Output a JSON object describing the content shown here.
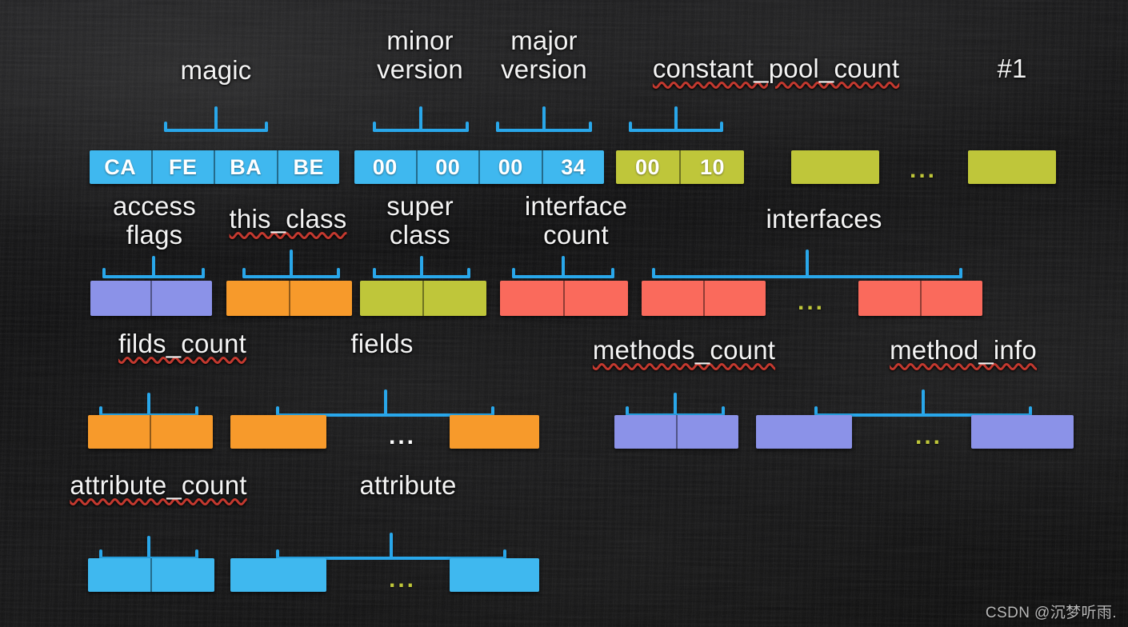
{
  "diagram": {
    "title": "Java .class file structure byte layout",
    "colors": {
      "blue": "#3fb8ef",
      "light_blue": "#3fb8ef",
      "olive": "#bfc63a",
      "lavender": "#8b92e8",
      "orange": "#f79a2b",
      "salmon": "#fa6a5c",
      "bracket": "#29a7ea",
      "label_text": "#f4f4f4",
      "spellcheck_underline": "#c4392f",
      "background": "#0d0d0e"
    },
    "rows": [
      {
        "id": "row-1",
        "labels": [
          {
            "id": "magic",
            "text": "magic",
            "spellcheck": false
          },
          {
            "id": "minor-version",
            "text": "minor\nversion",
            "spellcheck": false
          },
          {
            "id": "major-version",
            "text": "major\nversion",
            "spellcheck": false
          },
          {
            "id": "constant-pool-count",
            "text": "constant_pool_count",
            "spellcheck": true
          },
          {
            "id": "constant-pool-entry",
            "text": "#1",
            "spellcheck": false
          }
        ],
        "groups": [
          {
            "id": "magic-bytes",
            "color": "blue",
            "cells": [
              "CA",
              "FE",
              "BA",
              "BE"
            ]
          },
          {
            "id": "version-bytes",
            "color": "blue",
            "cells": [
              "00",
              "00",
              "00",
              "34"
            ]
          },
          {
            "id": "constant-pool-count-bytes",
            "color": "olive",
            "cells": [
              "00",
              "10"
            ]
          },
          {
            "id": "constant-pool-entry-1",
            "color": "olive",
            "cells": [
              ""
            ]
          },
          {
            "id": "constant-pool-entry-n",
            "color": "olive",
            "cells": [
              ""
            ]
          }
        ],
        "ellipsis": [
          {
            "id": "constant-pool-ellipsis",
            "text": "...",
            "color": "olive"
          }
        ]
      },
      {
        "id": "row-2",
        "labels": [
          {
            "id": "access-flags",
            "text": "access\nflags",
            "spellcheck": false
          },
          {
            "id": "this-class",
            "text": "this_class",
            "spellcheck": true
          },
          {
            "id": "super-class",
            "text": "super\nclass",
            "spellcheck": false
          },
          {
            "id": "interface-count",
            "text": "interface\ncount",
            "spellcheck": false
          },
          {
            "id": "interfaces",
            "text": "interfaces",
            "spellcheck": false
          }
        ],
        "groups": [
          {
            "id": "access-flags-bytes",
            "color": "lavender",
            "cells": [
              "",
              ""
            ]
          },
          {
            "id": "this-class-bytes",
            "color": "orange",
            "cells": [
              "",
              ""
            ]
          },
          {
            "id": "super-class-bytes",
            "color": "olive",
            "cells": [
              "",
              ""
            ]
          },
          {
            "id": "interface-count-bytes",
            "color": "salmon",
            "cells": [
              "",
              ""
            ]
          },
          {
            "id": "interface-entry-1",
            "color": "salmon",
            "cells": [
              "",
              ""
            ]
          },
          {
            "id": "interface-entry-n",
            "color": "salmon",
            "cells": [
              "",
              ""
            ]
          }
        ],
        "ellipsis": [
          {
            "id": "interfaces-ellipsis",
            "text": "...",
            "color": "olive"
          }
        ]
      },
      {
        "id": "row-3",
        "labels": [
          {
            "id": "filds-count",
            "text": "filds_count",
            "spellcheck": true
          },
          {
            "id": "fields",
            "text": "fields",
            "spellcheck": false
          },
          {
            "id": "methods-count",
            "text": "methods_count",
            "spellcheck": true
          },
          {
            "id": "method-info",
            "text": "method_info",
            "spellcheck": true
          }
        ],
        "groups": [
          {
            "id": "fields-count-bytes",
            "color": "orange",
            "cells": [
              "",
              ""
            ]
          },
          {
            "id": "field-info-1",
            "color": "orange",
            "cells": [
              ""
            ]
          },
          {
            "id": "field-info-n",
            "color": "orange",
            "cells": [
              ""
            ]
          },
          {
            "id": "methods-count-bytes",
            "color": "lavender",
            "cells": [
              "",
              ""
            ]
          },
          {
            "id": "method-info-1",
            "color": "lavender",
            "cells": [
              ""
            ]
          },
          {
            "id": "method-info-n",
            "color": "lavender",
            "cells": [
              ""
            ]
          }
        ],
        "ellipsis": [
          {
            "id": "fields-ellipsis",
            "text": "...",
            "color": "white"
          },
          {
            "id": "methods-ellipsis",
            "text": "...",
            "color": "olive"
          }
        ]
      },
      {
        "id": "row-4",
        "labels": [
          {
            "id": "attribute-count",
            "text": "attribute_count",
            "spellcheck": true
          },
          {
            "id": "attribute",
            "text": "attribute",
            "spellcheck": false
          }
        ],
        "groups": [
          {
            "id": "attribute-count-bytes",
            "color": "light_blue",
            "cells": [
              "",
              ""
            ]
          },
          {
            "id": "attribute-info-1",
            "color": "light_blue",
            "cells": [
              ""
            ]
          },
          {
            "id": "attribute-info-n",
            "color": "light_blue",
            "cells": [
              ""
            ]
          }
        ],
        "ellipsis": [
          {
            "id": "attributes-ellipsis",
            "text": "...",
            "color": "olive"
          }
        ]
      }
    ]
  },
  "watermark": {
    "text": "CSDN @沉梦听雨."
  }
}
